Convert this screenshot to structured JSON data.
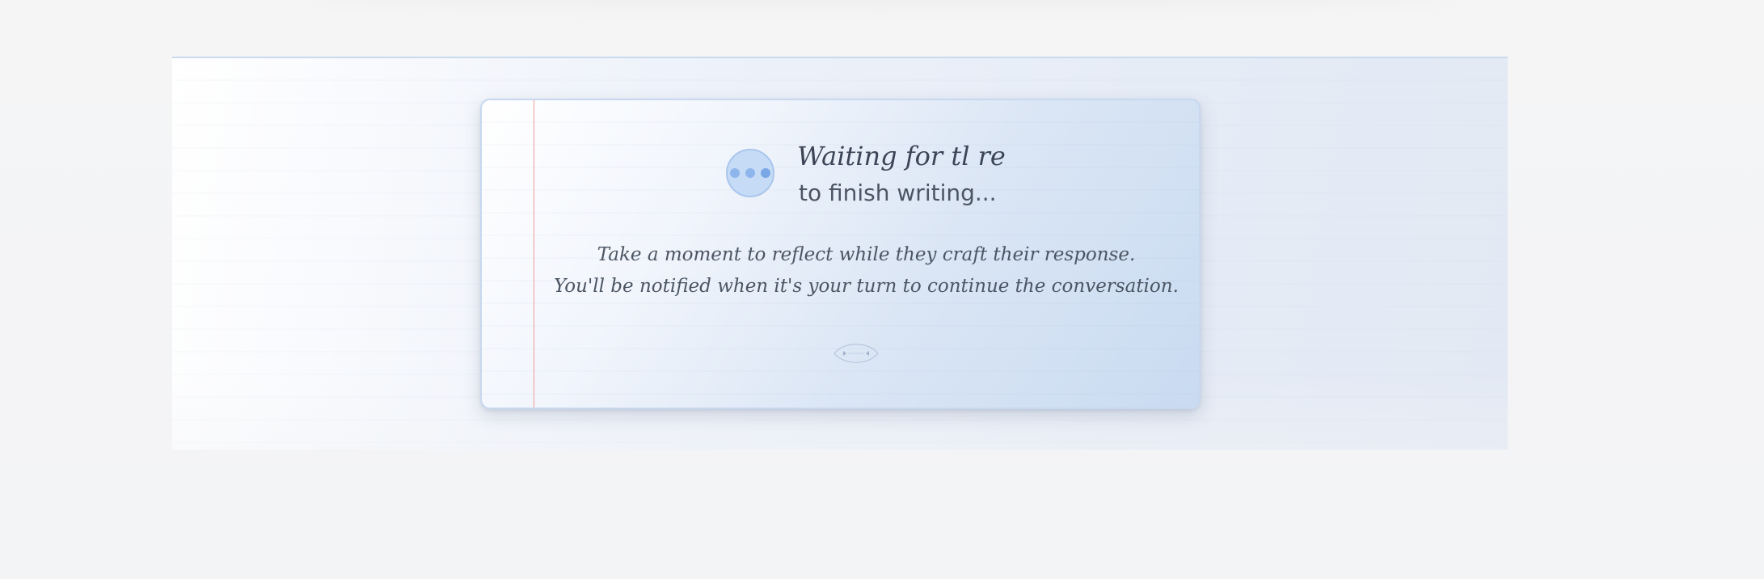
{
  "waiting_card": {
    "title": "Waiting for tl re",
    "subtitle": "to finish writing...",
    "message_line_1": "Take a moment to reflect while they craft their response.",
    "message_line_2": "You'll be notified when it's your turn to continue the conversation.",
    "typing_icon": "typing-dots-icon",
    "ornament_icon": "leaf-divider-icon"
  },
  "colors": {
    "accent": "#7aa8e6",
    "margin_line": "#ef9a9a",
    "text": "#4b5563"
  }
}
